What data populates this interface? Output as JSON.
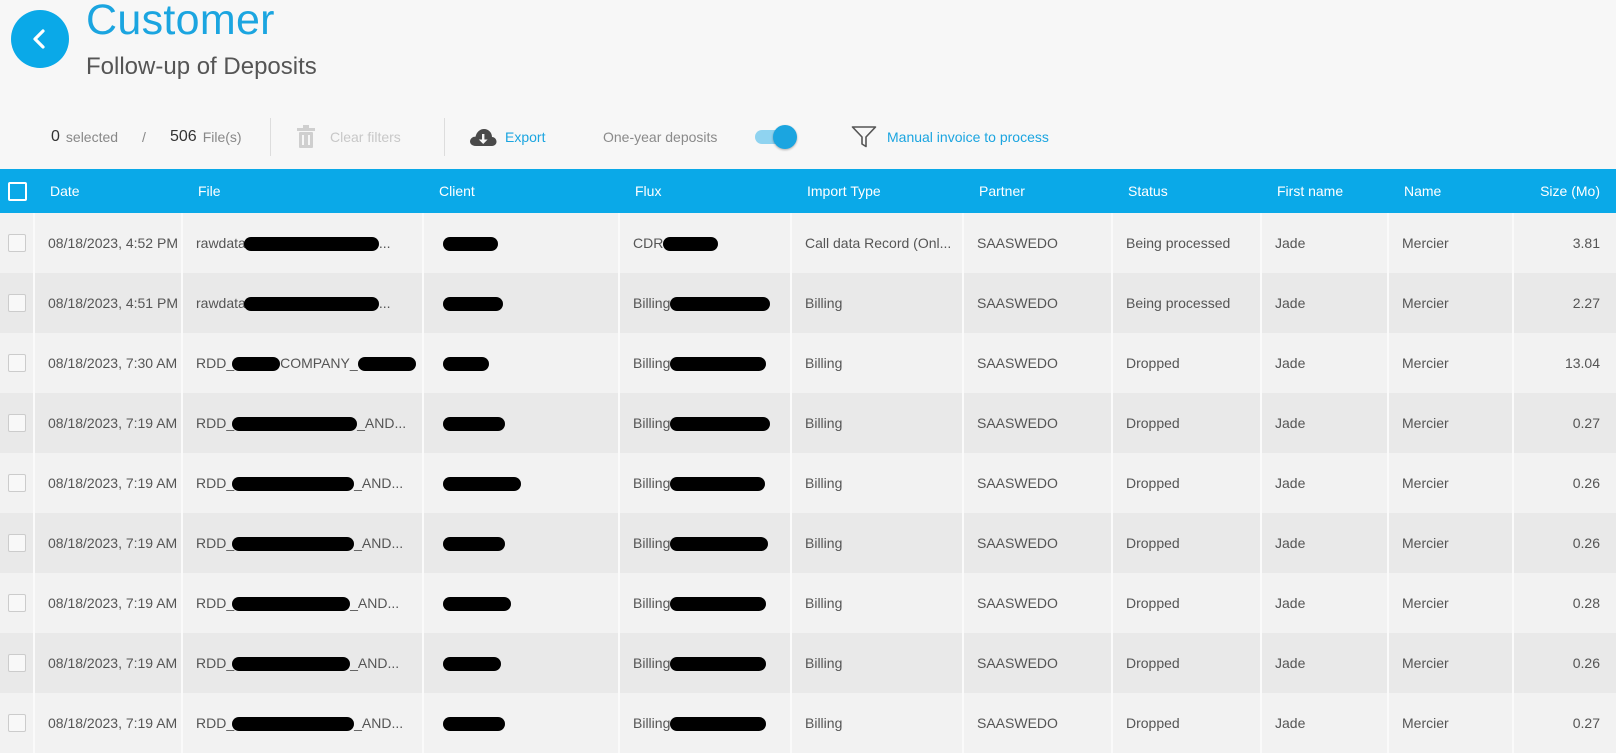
{
  "header": {
    "title": "Customer",
    "subtitle": "Follow-up of Deposits"
  },
  "toolbar": {
    "selected_count": "0",
    "selected_label": "selected",
    "slash": "/",
    "file_count": "506",
    "file_label": "File(s)",
    "clear_filters": "Clear filters",
    "export": "Export",
    "one_year_label": "One-year deposits",
    "one_year_enabled": true,
    "manual_invoice": "Manual invoice to process"
  },
  "colors": {
    "accent": "#0aa9e8",
    "header_text": "#ffffff"
  },
  "table": {
    "columns": [
      "Date",
      "File",
      "Client",
      "Flux",
      "Import Type",
      "Partner",
      "Status",
      "First name",
      "Name",
      "Size (Mo)"
    ],
    "rows": [
      {
        "date": "08/18/2023, 4:52 PM",
        "file": "rawdata",
        "file_suffix": "...",
        "flux": "CDR",
        "import_type": "Call data Record (Onl...",
        "partner": "SAASWEDO",
        "status": "Being processed",
        "first_name": "Jade",
        "name": "Mercier",
        "size": "3.81"
      },
      {
        "date": "08/18/2023, 4:51 PM",
        "file": "rawdata",
        "file_suffix": "...",
        "flux": "Billing",
        "import_type": "Billing",
        "partner": "SAASWEDO",
        "status": "Being processed",
        "first_name": "Jade",
        "name": "Mercier",
        "size": "2.27"
      },
      {
        "date": "08/18/2023, 7:30 AM",
        "file": "RDD_",
        "file_suffix": "COMPANY_",
        "flux": "Billing",
        "import_type": "Billing",
        "partner": "SAASWEDO",
        "status": "Dropped",
        "first_name": "Jade",
        "name": "Mercier",
        "size": "13.04"
      },
      {
        "date": "08/18/2023, 7:19 AM",
        "file": "RDD_",
        "file_suffix": "_AND...",
        "flux": "Billing",
        "import_type": "Billing",
        "partner": "SAASWEDO",
        "status": "Dropped",
        "first_name": "Jade",
        "name": "Mercier",
        "size": "0.27"
      },
      {
        "date": "08/18/2023, 7:19 AM",
        "file": "RDD_",
        "file_suffix": "_AND...",
        "flux": "Billing",
        "import_type": "Billing",
        "partner": "SAASWEDO",
        "status": "Dropped",
        "first_name": "Jade",
        "name": "Mercier",
        "size": "0.26"
      },
      {
        "date": "08/18/2023, 7:19 AM",
        "file": "RDD_",
        "file_suffix": "_AND...",
        "flux": "Billing",
        "import_type": "Billing",
        "partner": "SAASWEDO",
        "status": "Dropped",
        "first_name": "Jade",
        "name": "Mercier",
        "size": "0.26"
      },
      {
        "date": "08/18/2023, 7:19 AM",
        "file": "RDD_",
        "file_suffix": "_AND...",
        "flux": "Billing",
        "import_type": "Billing",
        "partner": "SAASWEDO",
        "status": "Dropped",
        "first_name": "Jade",
        "name": "Mercier",
        "size": "0.28"
      },
      {
        "date": "08/18/2023, 7:19 AM",
        "file": "RDD_",
        "file_suffix": "_AND...",
        "flux": "Billing",
        "import_type": "Billing",
        "partner": "SAASWEDO",
        "status": "Dropped",
        "first_name": "Jade",
        "name": "Mercier",
        "size": "0.26"
      },
      {
        "date": "08/18/2023, 7:19 AM",
        "file": "RDD_",
        "file_suffix": "_AND...",
        "flux": "Billing",
        "import_type": "Billing",
        "partner": "SAASWEDO",
        "status": "Dropped",
        "first_name": "Jade",
        "name": "Mercier",
        "size": "0.27"
      }
    ]
  }
}
